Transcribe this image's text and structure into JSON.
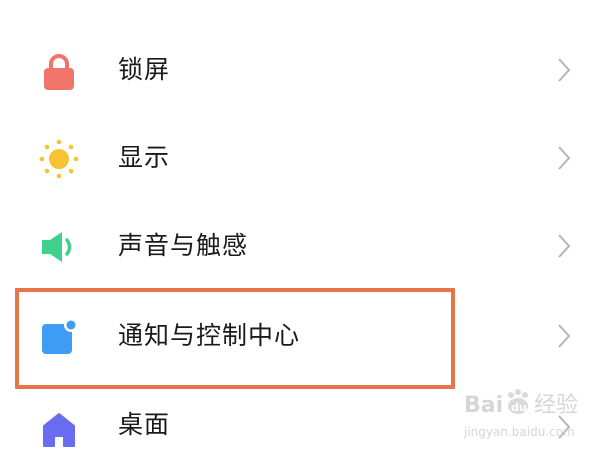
{
  "settings": {
    "items": [
      {
        "label": "锁屏",
        "icon": "lock-icon",
        "color": "#f1746b"
      },
      {
        "label": "显示",
        "icon": "sun-icon",
        "color": "#f7c331"
      },
      {
        "label": "声音与触感",
        "icon": "speaker-icon",
        "color": "#3ed18b"
      },
      {
        "label": "通知与控制中心",
        "icon": "notification-icon",
        "color": "#3e9cf5"
      },
      {
        "label": "桌面",
        "icon": "home-icon",
        "color": "#6a6cf0"
      }
    ],
    "highlight_index": 3,
    "highlight_color": "#e8744a"
  },
  "watermark": {
    "text": "Baidu经验",
    "url_text": "jingyan.baidu.com"
  }
}
